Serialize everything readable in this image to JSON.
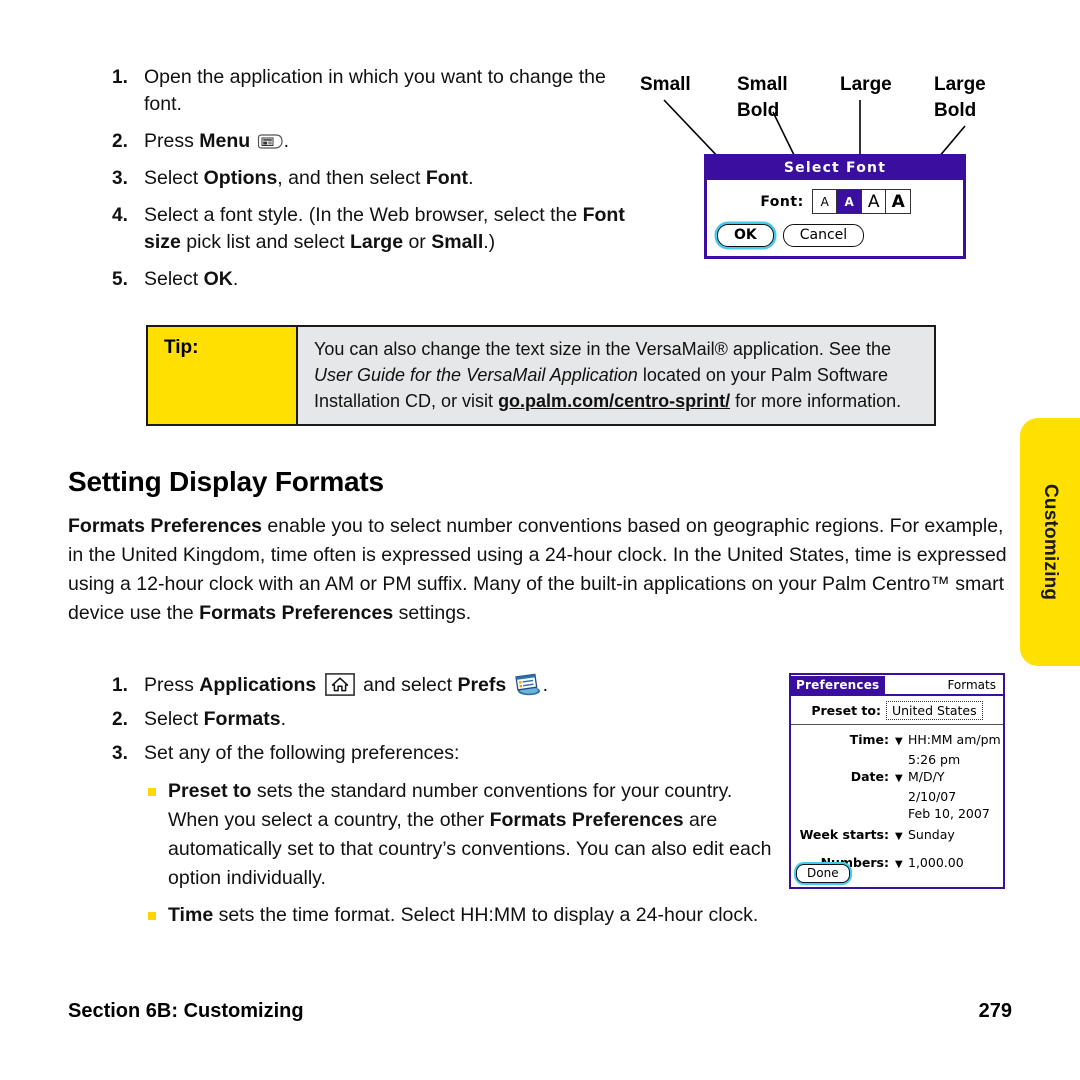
{
  "side_tab": {
    "label": "Customizing",
    "color": "#FFE000"
  },
  "steps_top": [
    {
      "num": "1.",
      "text_html": "Open the application in which you want to change the font."
    },
    {
      "num": "2.",
      "text_pre": "Press ",
      "bold": "Menu",
      "icon": "menu-key-icon",
      "text_post": "."
    },
    {
      "num": "3.",
      "text_html": "Select <b>Options</b>, and then select <b>Font</b>."
    },
    {
      "num": "4.",
      "text_html": "Select a font style. (In the Web browser, select the <b>Font size</b> pick list and select <b>Large</b> or <b>Small</b>.)"
    },
    {
      "num": "5.",
      "text_html": "Select <b>OK</b>."
    }
  ],
  "callout": {
    "labels": [
      "Small",
      "Small\nBold",
      "Large",
      "Large\nBold"
    ],
    "label_1": "Small",
    "label_2_line1": "Small",
    "label_2_line2": "Bold",
    "label_3": "Large",
    "label_4_line1": "Large",
    "label_4_line2": "Bold",
    "dialog": {
      "title": "Select Font",
      "field_label": "Font:",
      "options": [
        {
          "glyph": "A",
          "style": "small",
          "selected": false
        },
        {
          "glyph": "A",
          "style": "small-bold",
          "selected": true
        },
        {
          "glyph": "A",
          "style": "large",
          "selected": false
        },
        {
          "glyph": "A",
          "style": "large-bold",
          "selected": false
        }
      ],
      "ok_label": "OK",
      "cancel_label": "Cancel",
      "accent_color": "#3A0FA0",
      "focus_color": "#46C8F0"
    }
  },
  "tip": {
    "label": "Tip:",
    "body_part1": "You can also change the text size in the VersaMail® application. See the ",
    "body_italic": "User Guide for the VersaMail Application",
    "body_part2": " located on your Palm Software Installation CD, or visit ",
    "body_link": "go.palm.com/centro-sprint/",
    "body_part3": " for more information.",
    "label_color": "#FFE000",
    "body_color": "#E6E7E8"
  },
  "heading": "Setting Display Formats",
  "paragraph": {
    "bold1": "Formats Preferences",
    "part1": " enable you to select number conventions based on geographic regions. For example, in the United Kingdom, time often is expressed using a 24-hour clock. In the United States, time is expressed using a 12-hour clock with an AM or PM suffix. Many of the built-in applications on your Palm Centro™ smart device use the ",
    "bold2": "Formats Preferences",
    "part2": " settings."
  },
  "steps_bottom": [
    {
      "num": "1.",
      "pre": "Press ",
      "bold": "Applications",
      "mid": " and select ",
      "bold2": "Prefs",
      "post": "."
    },
    {
      "num": "2.",
      "text_html": "Select <b>Formats</b>."
    },
    {
      "num": "3.",
      "text_html": "Set any of the following preferences:"
    }
  ],
  "bullets": [
    {
      "bold": "Preset to",
      "text": " sets the standard number conventions for your country. When you select a country, the other ",
      "bold2": "Formats Preferences",
      "text2": " are automatically set to that country’s conventions. You can also edit each option individually."
    },
    {
      "bold": "Time",
      "text": " sets the time format. Select HH:MM to display a 24-hour clock.",
      "bold2": "",
      "text2": ""
    }
  ],
  "bullet_color": "#FFD500",
  "prefs_screen": {
    "title_left": "Preferences",
    "title_right": "Formats",
    "preset_label": "Preset to:",
    "preset_value": "United States",
    "rows": [
      {
        "label": "Time:",
        "caret": "▼",
        "value": "HH:MM am/pm",
        "sub": [
          "5:26 pm"
        ]
      },
      {
        "label": "Date:",
        "caret": "▼",
        "value": "M/D/Y",
        "sub": [
          "2/10/07",
          "Feb 10, 2007"
        ]
      },
      {
        "label": "Week starts:",
        "caret": "▼",
        "value": "Sunday",
        "sub": []
      },
      {
        "label": "Numbers:",
        "caret": "▼",
        "value": "1,000.00",
        "sub": []
      }
    ],
    "done_label": "Done",
    "accent_color": "#3A0FA0"
  },
  "footer": {
    "left": "Section 6B: Customizing",
    "right": "279"
  }
}
